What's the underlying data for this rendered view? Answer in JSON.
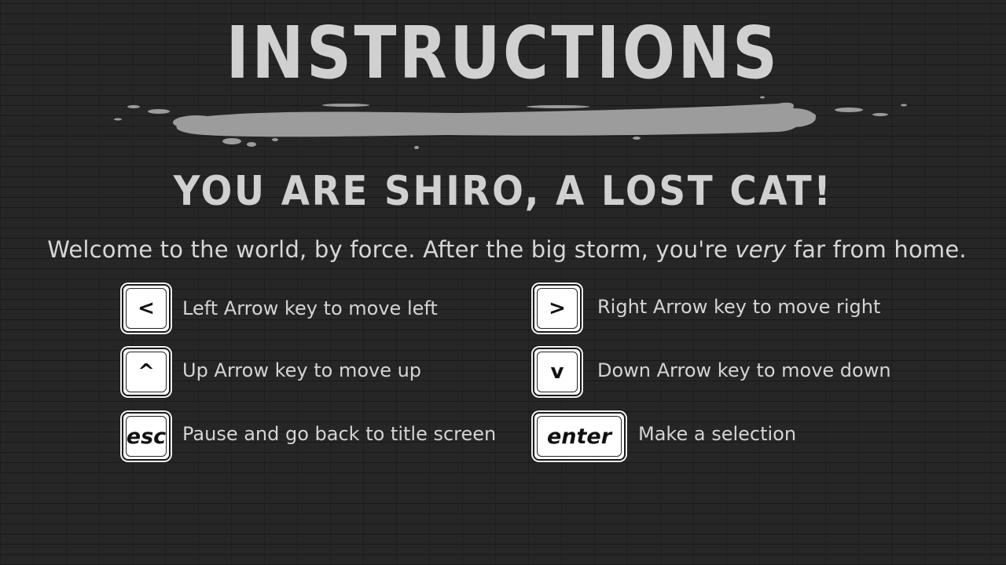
{
  "screen": {
    "title": "INSTRUCTIONS",
    "subtitle": "YOU ARE SHIRO, A LOST CAT!",
    "welcome": {
      "before": "Welcome to the world, by force. After the big storm, you're ",
      "emphasis": "very",
      "after": " far from home."
    }
  },
  "controls": {
    "left": {
      "key": "<",
      "label": "Left Arrow key to move left"
    },
    "right": {
      "key": ">",
      "label": "Right Arrow key to move right"
    },
    "up": {
      "key": "^",
      "label": "Up Arrow key to move up"
    },
    "down": {
      "key": "v",
      "label": "Down Arrow key to move down"
    },
    "esc": {
      "key": "esc",
      "label": "Pause and go back to title screen"
    },
    "enter": {
      "key": "enter",
      "label": "Make a selection"
    }
  },
  "colors": {
    "background": "#262626",
    "text": "#d2d2d2",
    "brush": "#9a9a9a",
    "key_face": "#ffffff"
  }
}
